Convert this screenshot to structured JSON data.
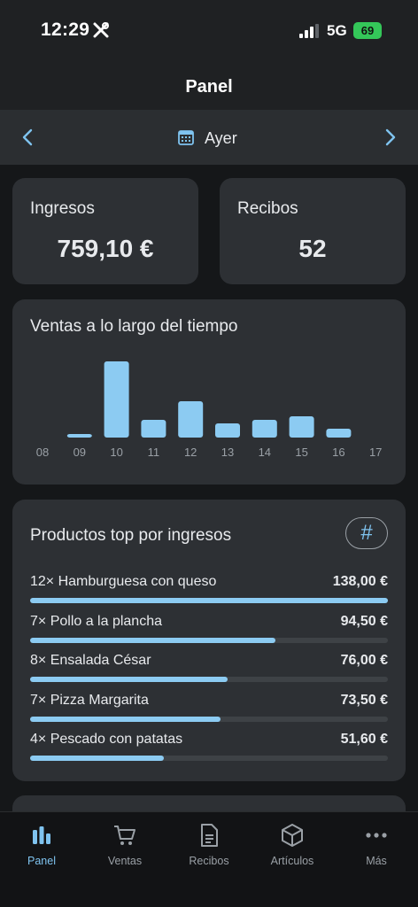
{
  "status": {
    "time": "12:29",
    "network": "5G",
    "battery": "69"
  },
  "header": {
    "title": "Panel"
  },
  "date_nav": {
    "label": "Ayer"
  },
  "stats": [
    {
      "label": "Ingresos",
      "value": "759,10 €"
    },
    {
      "label": "Recibos",
      "value": "52"
    }
  ],
  "chart_card": {
    "title": "Ventas a lo largo del tiempo"
  },
  "chart_data": {
    "type": "bar",
    "title": "Ventas a lo largo del tiempo",
    "categories": [
      "08",
      "09",
      "10",
      "11",
      "12",
      "13",
      "14",
      "15",
      "16",
      "17"
    ],
    "values": [
      0,
      4,
      86,
      20,
      41,
      16,
      20,
      24,
      10,
      0
    ],
    "xlabel": "",
    "ylabel": "",
    "grid": false,
    "bar_color": "#8ccbf2"
  },
  "top_products": {
    "title": "Productos top por ingresos",
    "toggle_label": "#",
    "items": [
      {
        "name": "12× Hamburguesa con queso",
        "value": "138,00 €",
        "fraction": 1.0
      },
      {
        "name": "7× Pollo a la plancha",
        "value": "94,50 €",
        "fraction": 0.685
      },
      {
        "name": "8× Ensalada César",
        "value": "76,00 €",
        "fraction": 0.551
      },
      {
        "name": "7× Pizza Margarita",
        "value": "73,50 €",
        "fraction": 0.533
      },
      {
        "name": "4× Pescado con patatas",
        "value": "51,60 €",
        "fraction": 0.374
      }
    ]
  },
  "tabs": [
    {
      "label": "Panel",
      "icon": "bar-chart-icon",
      "active": true
    },
    {
      "label": "Ventas",
      "icon": "cart-icon",
      "active": false
    },
    {
      "label": "Recibos",
      "icon": "document-icon",
      "active": false
    },
    {
      "label": "Artículos",
      "icon": "box-icon",
      "active": false
    },
    {
      "label": "Más",
      "icon": "more-icon",
      "active": false
    }
  ],
  "colors": {
    "accent": "#7fc3ef",
    "bar": "#8ccbf2",
    "card": "#2d3034",
    "background": "#151719"
  }
}
